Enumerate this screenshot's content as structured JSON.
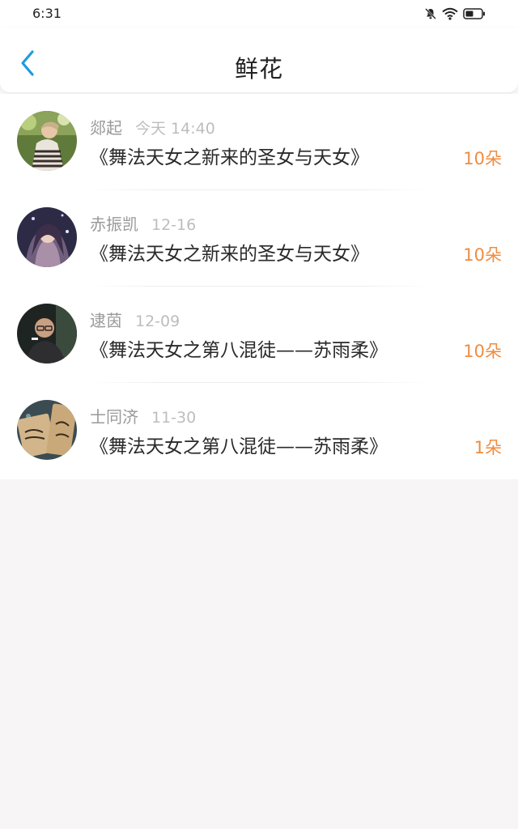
{
  "status_bar": {
    "time": "6:31"
  },
  "header": {
    "title": "鲜花"
  },
  "colors": {
    "accent": "#1e9be0",
    "amount": "#ef8c40",
    "background": "#f7f5f5"
  },
  "records": [
    {
      "name": "郯起",
      "time": "今天 14:40",
      "book": "《舞法天女之新来的圣女与天女》",
      "amount": "10朵"
    },
    {
      "name": "赤振凯",
      "time": "12-16",
      "book": "《舞法天女之新来的圣女与天女》",
      "amount": "10朵"
    },
    {
      "name": "逮茵",
      "time": "12-09",
      "book": "《舞法天女之第八混徒——苏雨柔》",
      "amount": "10朵"
    },
    {
      "name": "士同济",
      "time": "11-30",
      "book": "《舞法天女之第八混徒——苏雨柔》",
      "amount": "1朵"
    }
  ]
}
